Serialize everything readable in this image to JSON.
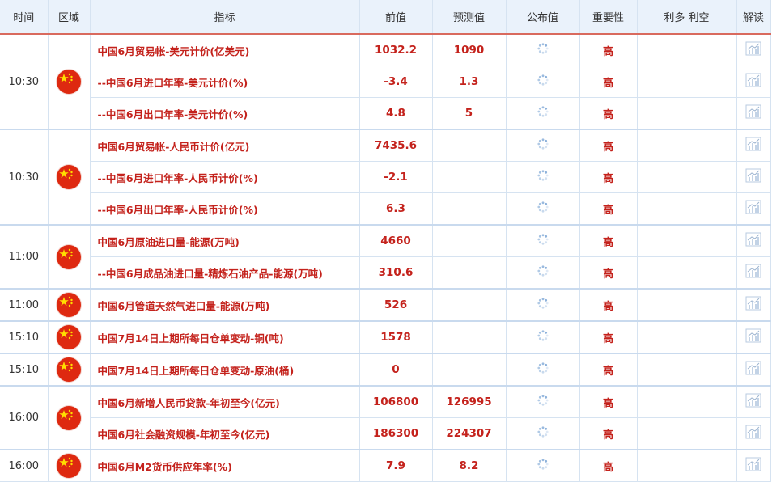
{
  "headers": {
    "time": "时间",
    "region": "区域",
    "indicator": "指标",
    "previous": "前值",
    "forecast": "预测值",
    "actual": "公布值",
    "importance": "重要性",
    "impact": "利多 利空",
    "analysis": "解读"
  },
  "colors": {
    "accent_red": "#c4221c",
    "header_bg": "#eaf2fb",
    "border": "#d6e3f1",
    "flag_red": "#de2910",
    "flag_star": "#ffde00"
  },
  "groups": [
    {
      "time": "10:30",
      "region_icon": "china-flag-icon",
      "rows": [
        {
          "indicator": "中国6月贸易帐-美元计价(亿美元)",
          "previous": "1032.2",
          "forecast": "1090",
          "importance": "高"
        },
        {
          "indicator": "--中国6月进口年率-美元计价(%)",
          "previous": "-3.4",
          "forecast": "1.3",
          "importance": "高"
        },
        {
          "indicator": "--中国6月出口年率-美元计价(%)",
          "previous": "4.8",
          "forecast": "5",
          "importance": "高"
        }
      ]
    },
    {
      "time": "10:30",
      "region_icon": "china-flag-icon",
      "rows": [
        {
          "indicator": "中国6月贸易帐-人民币计价(亿元)",
          "previous": "7435.6",
          "forecast": "",
          "importance": "高"
        },
        {
          "indicator": "--中国6月进口年率-人民币计价(%)",
          "previous": "-2.1",
          "forecast": "",
          "importance": "高"
        },
        {
          "indicator": "--中国6月出口年率-人民币计价(%)",
          "previous": "6.3",
          "forecast": "",
          "importance": "高"
        }
      ]
    },
    {
      "time": "11:00",
      "region_icon": "china-flag-icon",
      "rows": [
        {
          "indicator": "中国6月原油进口量-能源(万吨)",
          "previous": "4660",
          "forecast": "",
          "importance": "高"
        },
        {
          "indicator": "--中国6月成品油进口量-精炼石油产品-能源(万吨)",
          "previous": "310.6",
          "forecast": "",
          "importance": "高"
        }
      ]
    },
    {
      "time": "11:00",
      "region_icon": "china-flag-icon",
      "rows": [
        {
          "indicator": "中国6月管道天然气进口量-能源(万吨)",
          "previous": "526",
          "forecast": "",
          "importance": "高"
        }
      ]
    },
    {
      "time": "15:10",
      "region_icon": "china-flag-icon",
      "rows": [
        {
          "indicator": "中国7月14日上期所每日仓单变动-铜(吨)",
          "previous": "1578",
          "forecast": "",
          "importance": "高"
        }
      ]
    },
    {
      "time": "15:10",
      "region_icon": "china-flag-icon",
      "rows": [
        {
          "indicator": "中国7月14日上期所每日仓单变动-原油(桶)",
          "previous": "0",
          "forecast": "",
          "importance": "高"
        }
      ]
    },
    {
      "time": "16:00",
      "region_icon": "china-flag-icon",
      "rows": [
        {
          "indicator": "中国6月新增人民币贷款-年初至今(亿元)",
          "previous": "106800",
          "forecast": "126995",
          "importance": "高"
        },
        {
          "indicator": "中国6月社会融资规模-年初至今(亿元)",
          "previous": "186300",
          "forecast": "224307",
          "importance": "高"
        }
      ]
    },
    {
      "time": "16:00",
      "region_icon": "china-flag-icon",
      "rows": [
        {
          "indicator": "中国6月M2货币供应年率(%)",
          "previous": "7.9",
          "forecast": "8.2",
          "importance": "高"
        }
      ]
    }
  ]
}
